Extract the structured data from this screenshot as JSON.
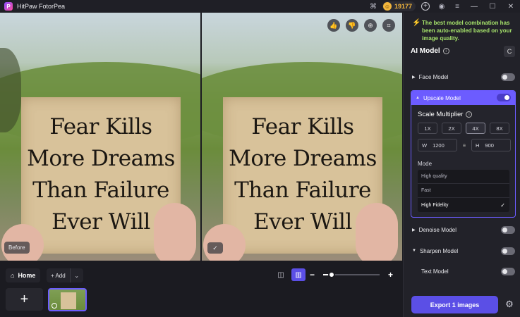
{
  "app": {
    "title": "HitPaw FotorPea",
    "logo_letter": "P"
  },
  "titlebar": {
    "credits": "19177",
    "minimize": "—",
    "maximize": "☐",
    "close": "✕"
  },
  "preview": {
    "quote_lines": [
      "Fear Kills",
      "More Dreams",
      "Than Failure",
      "Ever Will"
    ],
    "before_label": "Before",
    "after_check": "✓"
  },
  "bottom": {
    "home_label": "Home",
    "add_label": "+ Add",
    "zoom_level": 0.15
  },
  "sidebar": {
    "notice": "The best model combination has been auto-enabled based on your image quality.",
    "section_title": "AI Model",
    "reset_icon": "C",
    "models": {
      "face": {
        "label": "Face Model",
        "on": false
      },
      "upscale": {
        "label": "Upscale Model",
        "on": true
      },
      "denoise": {
        "label": "Denoise Model",
        "on": false
      },
      "sharpen": {
        "label": "Sharpen Model",
        "on": false
      },
      "text": {
        "label": "Text Model",
        "on": false
      }
    },
    "scale": {
      "title": "Scale Multiplier",
      "options": [
        "1X",
        "2X",
        "4X",
        "8X"
      ],
      "selected": "4X",
      "width_label": "W",
      "width_value": "1200",
      "height_label": "H",
      "height_value": "900"
    },
    "mode": {
      "label": "Mode",
      "options": [
        "High quality",
        "Fast",
        "High Fidelity"
      ],
      "selected": "High Fidelity"
    },
    "export_label": "Export 1 images"
  }
}
